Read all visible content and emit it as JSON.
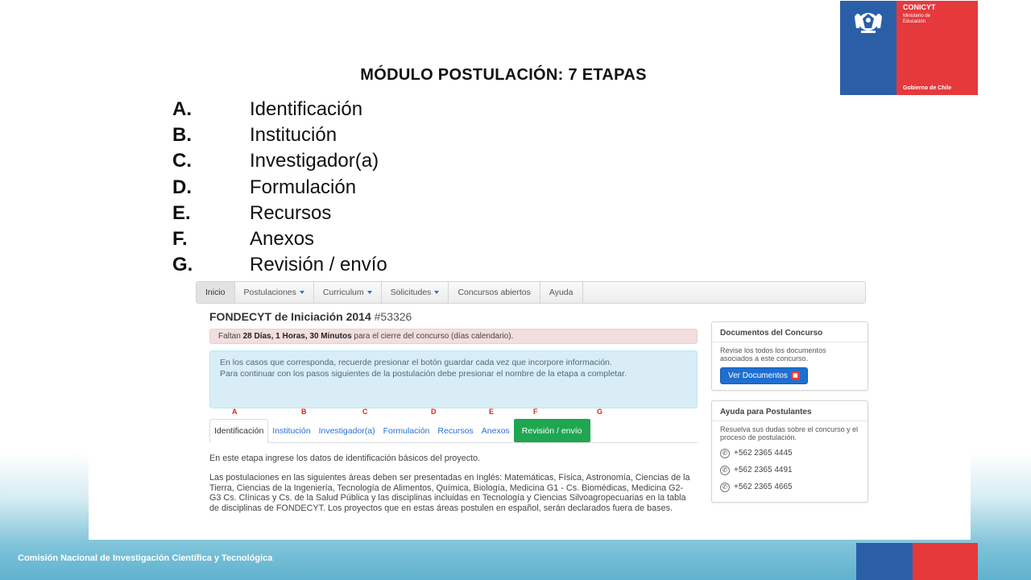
{
  "slide": {
    "title": "MÓDULO POSTULACIÓN: 7 ETAPAS",
    "stages": [
      {
        "key": "A.",
        "label": "Identificación"
      },
      {
        "key": "B.",
        "label": "Institución"
      },
      {
        "key": "C.",
        "label": "Investigador(a)"
      },
      {
        "key": "D.",
        "label": "Formulación"
      },
      {
        "key": "E.",
        "label": "Recursos"
      },
      {
        "key": "F.",
        "label": "Anexos"
      },
      {
        "key": "G.",
        "label": "Revisión / envío"
      }
    ],
    "footer": "Comisión Nacional de Investigación Científica y Tecnológica"
  },
  "logo": {
    "brand": "CONICYT",
    "sub1": "Ministerio de",
    "sub2": "Educación",
    "gov": "Gobierno de Chile"
  },
  "navbar": {
    "items": [
      {
        "label": "Inicio",
        "caret": false
      },
      {
        "label": "Postulaciones",
        "caret": true
      },
      {
        "label": "Curriculum",
        "caret": true
      },
      {
        "label": "Solicitudes",
        "caret": true
      },
      {
        "label": "Concursos abiertos",
        "caret": false
      },
      {
        "label": "Ayuda",
        "caret": false
      }
    ]
  },
  "project": {
    "title": "FONDECYT de Iniciación 2014",
    "number": "#53326"
  },
  "deadline": {
    "prefix": "Faltan",
    "bold": "28 Días, 1 Horas, 30 Minutos",
    "suffix": "para el cierre del concurso (días calendario)."
  },
  "info": {
    "line1": "En los casos que corresponda, recuerde presionar el botón guardar cada vez que incorpore información.",
    "line2": "Para continuar con los pasos siguientes de la postulación debe presionar el nombre de la etapa a completar."
  },
  "tab_letters": [
    "A",
    "B",
    "C",
    "D",
    "E",
    "F",
    "G"
  ],
  "tabs": [
    {
      "label": "Identificación",
      "state": "active"
    },
    {
      "label": "Institución",
      "state": "normal"
    },
    {
      "label": "Investigador(a)",
      "state": "normal"
    },
    {
      "label": "Formulación",
      "state": "normal"
    },
    {
      "label": "Recursos",
      "state": "normal"
    },
    {
      "label": "Anexos",
      "state": "normal"
    },
    {
      "label": "Revisión / envío",
      "state": "green"
    }
  ],
  "content": {
    "p1": "En este etapa ingrese los datos de identificación básicos del proyecto.",
    "p2": "Las postulaciones en las siguientes áreas deben ser presentadas en Inglés: Matemáticas, Física, Astronomía, Ciencias de la Tierra, Ciencias de la Ingeniería, Tecnología de Alimentos, Química, Biología, Medicina G1 - Cs. Biomédicas, Medicina G2-G3 Cs. Clínicas y Cs. de la Salud Pública y las disciplinas incluidas en Tecnología y Ciencias Silvoagropecuarias en la tabla de disciplinas de FONDECYT. Los proyectos que en estas áreas postulen en español, serán declarados fuera de bases."
  },
  "docs_panel": {
    "title": "Documentos del Concurso",
    "text": "Revise los todos los documentos asociados a este concurso.",
    "button": "Ver Documentos"
  },
  "help_panel": {
    "title": "Ayuda para Postulantes",
    "text": "Resuelva sus dudas sobre el concurso y el proceso de postulación.",
    "phones": [
      "+562 2365 4445",
      "+562 2365 4491",
      "+562 2365 4665"
    ]
  },
  "colors": {
    "accent_blue": "#2a6fd6",
    "green_tab": "#1fa650",
    "letter_red": "#e52020",
    "flag_blue": "#2a5fa8",
    "flag_red": "#e5393c"
  }
}
